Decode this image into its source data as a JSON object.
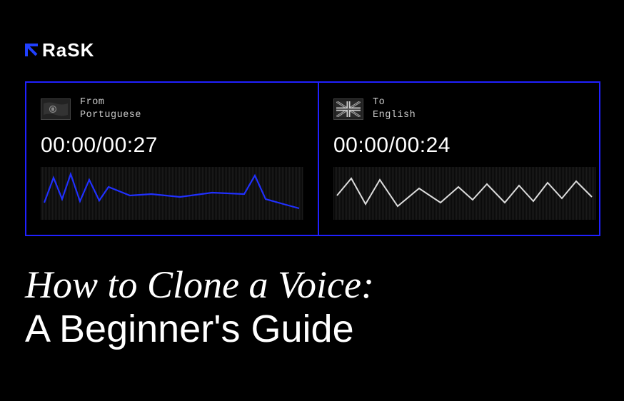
{
  "logo": {
    "text": "RaSK"
  },
  "left": {
    "label": "From",
    "language": "Portuguese",
    "time": "00:00/00:27"
  },
  "right": {
    "label": "To",
    "language": "English",
    "time": "00:00/00:24"
  },
  "headline": {
    "line1": "How to Clone a Voice:",
    "line2": "A Beginner's Guide"
  }
}
